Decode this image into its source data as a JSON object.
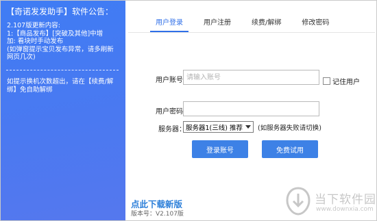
{
  "notice": {
    "title": "【奇诺发发助手】软件公告：",
    "body": "2.107版更新内容:\n1:【商品发布】[突破及其他]中增\n加: 看块时手动发布\n(如弹窗提示宝贝发布异常，请多刷新\n网页几次)",
    "hint": "如提示换机次数超出，请在【续费/解\n绑】免自助解绑"
  },
  "footer": {
    "download_link": "点此下载新版",
    "version": "版本号：V2.107版"
  },
  "tabs": [
    {
      "label": "用户登录",
      "active": true
    },
    {
      "label": "用户注册",
      "active": false
    },
    {
      "label": "续费/解绑",
      "active": false
    },
    {
      "label": "修改密码",
      "active": false
    }
  ],
  "form": {
    "account_label": "用户账号：",
    "account_placeholder": "请输入账号",
    "account_value": "",
    "remember_label": "记住用户",
    "password_label": "用户密码：",
    "password_value": "",
    "server_label": "服务器：",
    "server_value": "服务器1(三线) 推荐",
    "server_hint": "(如服务器失败请切换)",
    "login_button": "登录账号",
    "trial_button": "免费试用"
  },
  "watermark": {
    "title": "当下软件园",
    "url": "www.downxia.com"
  },
  "colors": {
    "panel_blue": "#4a79f1",
    "accent": "#2f6fe8",
    "button": "#3d81e6",
    "link": "#2c7fd9"
  },
  "icons": [
    "chevron-down-icon",
    "watermark-logo-icon"
  ]
}
